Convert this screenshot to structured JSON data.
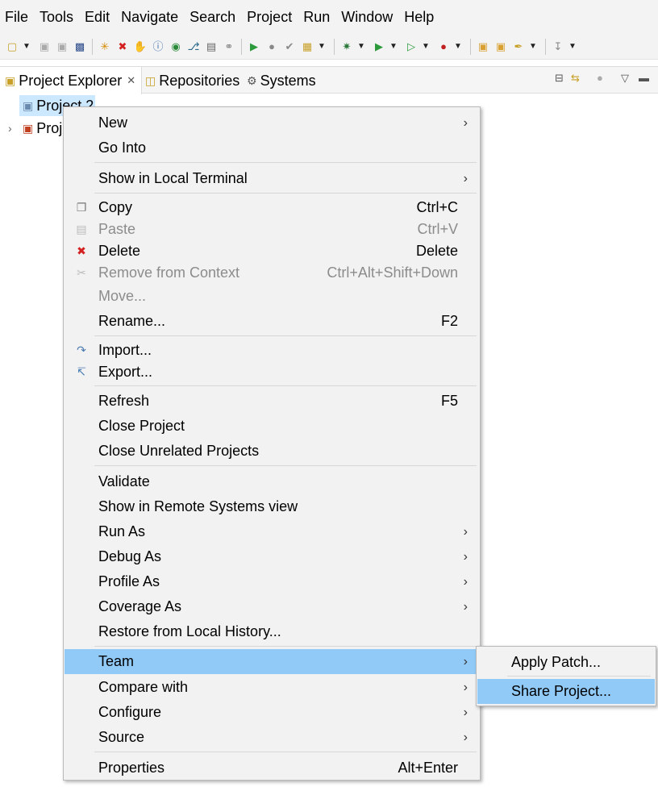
{
  "menubar": [
    "File",
    "Tools",
    "Edit",
    "Navigate",
    "Search",
    "Project",
    "Run",
    "Window",
    "Help"
  ],
  "tabs": {
    "project_explorer": "Project Explorer",
    "repositories": "Repositories",
    "systems": "Systems"
  },
  "tree": {
    "item1": "Project 2",
    "item2": "Proj"
  },
  "context_menu": {
    "new": "New",
    "go_into": "Go Into",
    "show_local_terminal": "Show in Local Terminal",
    "copy": "Copy",
    "copy_sc": "Ctrl+C",
    "paste": "Paste",
    "paste_sc": "Ctrl+V",
    "delete": "Delete",
    "delete_sc": "Delete",
    "remove_context": "Remove from Context",
    "remove_context_sc": "Ctrl+Alt+Shift+Down",
    "move": "Move...",
    "rename": "Rename...",
    "rename_sc": "F2",
    "import": "Import...",
    "export": "Export...",
    "refresh": "Refresh",
    "refresh_sc": "F5",
    "close_project": "Close Project",
    "close_unrelated": "Close Unrelated Projects",
    "validate": "Validate",
    "show_remote": "Show in Remote Systems view",
    "run_as": "Run As",
    "debug_as": "Debug As",
    "profile_as": "Profile As",
    "coverage_as": "Coverage As",
    "restore_history": "Restore from Local History...",
    "team": "Team",
    "compare_with": "Compare with",
    "configure": "Configure",
    "source": "Source",
    "properties": "Properties",
    "properties_sc": "Alt+Enter"
  },
  "team_submenu": {
    "apply_patch": "Apply Patch...",
    "share_project": "Share Project..."
  },
  "colors": {
    "hover": "#91c9f7",
    "selection": "#cce8ff",
    "menu_bg": "#f2f2f2"
  }
}
